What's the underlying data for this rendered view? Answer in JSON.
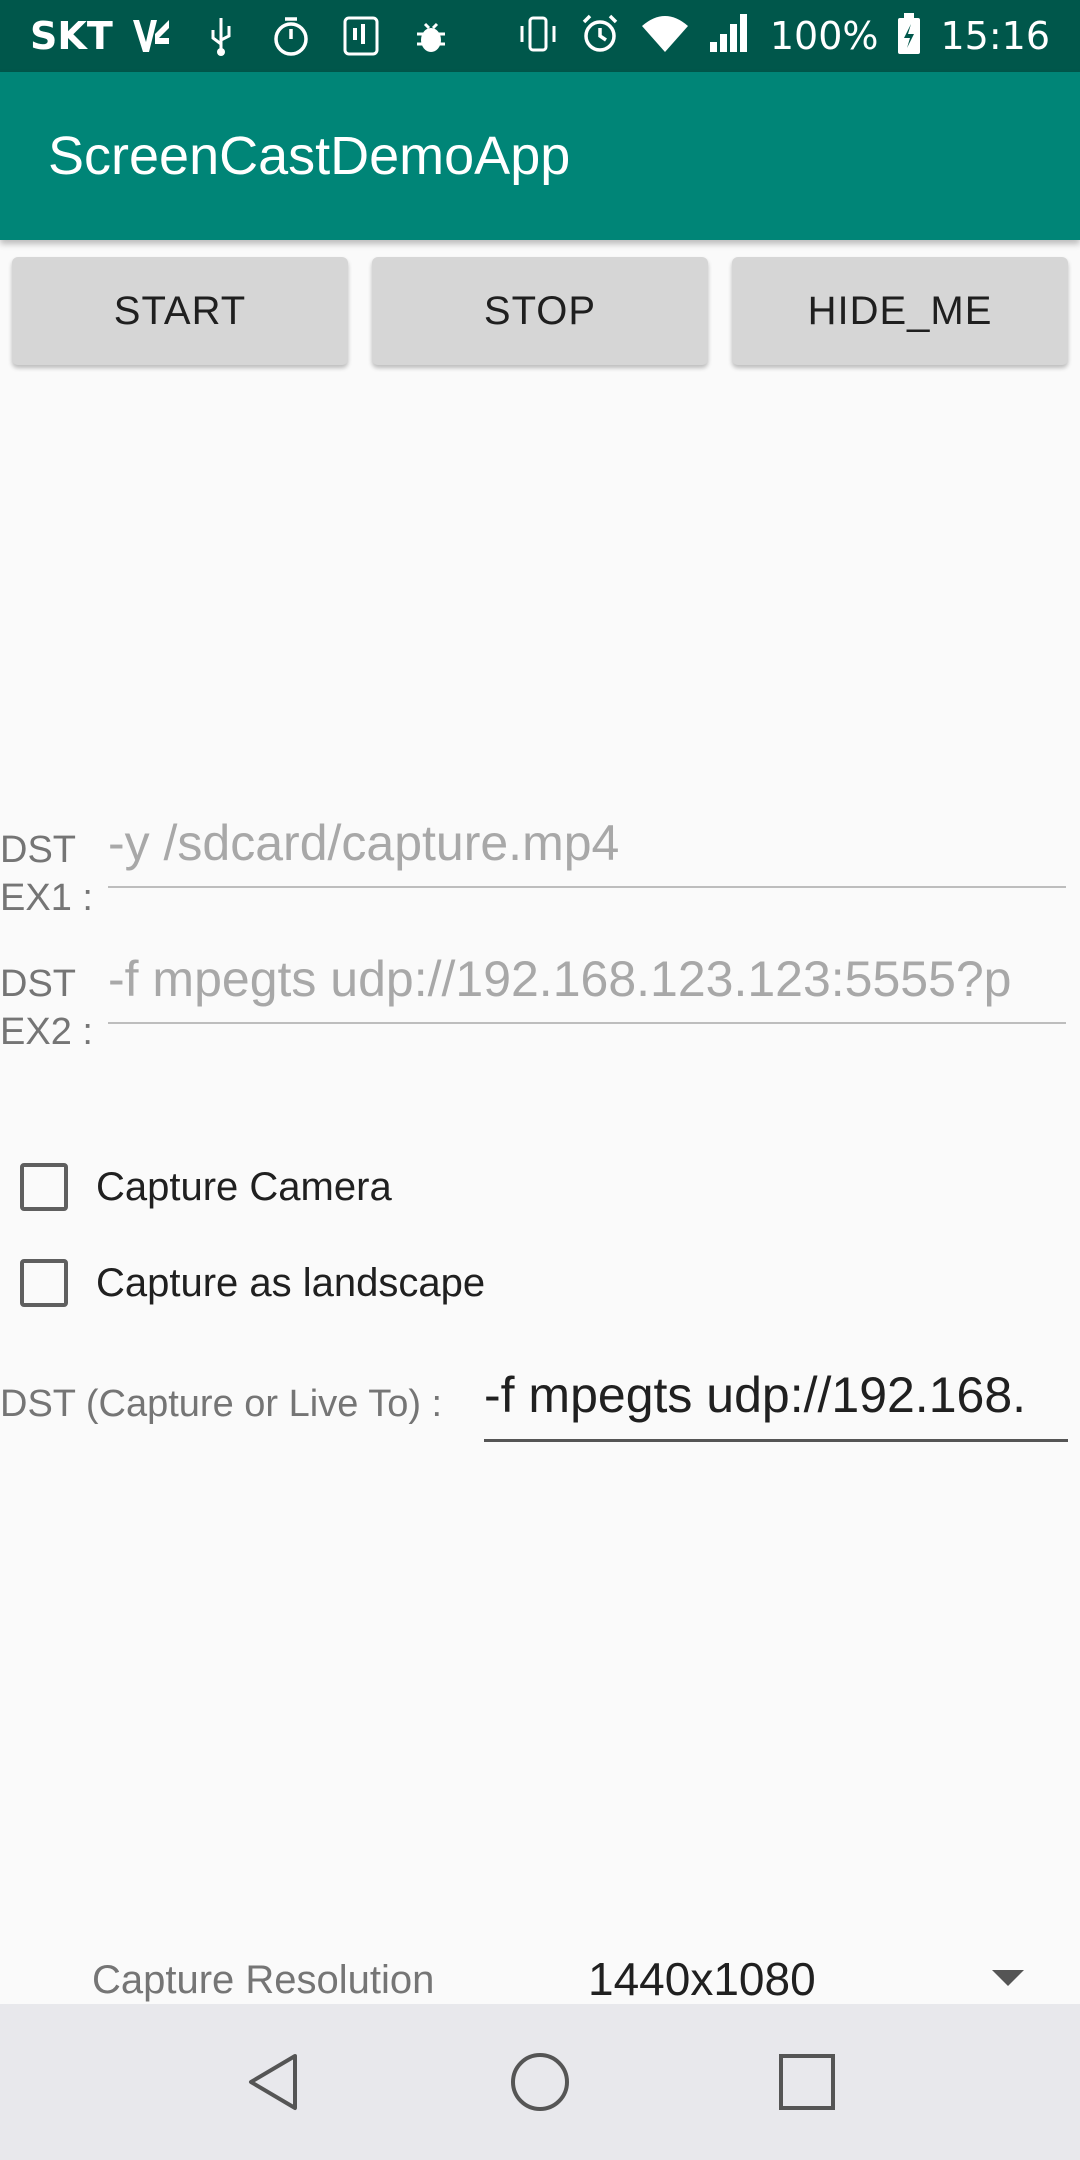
{
  "status_bar": {
    "carrier": "SKT",
    "battery": "100%",
    "time": "15:16",
    "icons_left": [
      "vpn-icon",
      "usb-icon",
      "timer-icon",
      "sim-icon",
      "bug-icon"
    ],
    "icons_right": [
      "vibrate-icon",
      "alarm-icon",
      "wifi-icon",
      "signal-icon",
      "battery-icon"
    ]
  },
  "appbar": {
    "title": "ScreenCastDemoApp"
  },
  "buttons": {
    "start": "START",
    "stop": "STOP",
    "hide": "HIDE_ME"
  },
  "dst_ex1": {
    "label_line1": "DST",
    "label_line2": "EX1 :",
    "placeholder": "-y /sdcard/capture.mp4"
  },
  "dst_ex2": {
    "label_line1": "DST",
    "label_line2": "EX2 :",
    "placeholder": "-f mpegts udp://192.168.123.123:5555?p"
  },
  "checkboxes": {
    "capture_camera": {
      "label": "Capture Camera",
      "checked": false
    },
    "capture_landscape": {
      "label": "Capture as landscape",
      "checked": false
    }
  },
  "dst_main": {
    "label": "DST (Capture or Live To) :",
    "value": "-f mpegts udp://192.168."
  },
  "resolution": {
    "label": "Capture Resolution",
    "value": "1440x1080"
  },
  "colors": {
    "appbar": "#008577",
    "statusbar": "#00574b",
    "button": "#d6d6d6"
  }
}
